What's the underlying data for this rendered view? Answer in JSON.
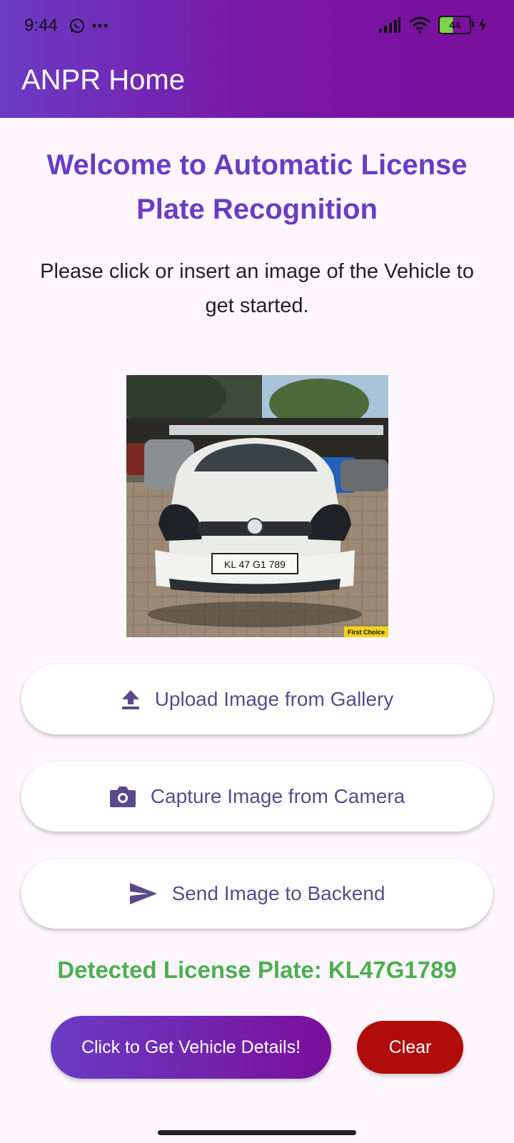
{
  "status_bar": {
    "time": "9:44",
    "battery_level": "44",
    "icons": [
      "whatsapp-icon",
      "more-dots-icon",
      "signal-icon",
      "wifi-icon",
      "battery-icon",
      "charging-icon"
    ]
  },
  "appbar": {
    "title": "ANPR Home"
  },
  "main": {
    "welcome": "Welcome to Automatic License Plate Recognition",
    "subtitle": "Please click or insert an image of the Vehicle to get started.",
    "image": {
      "plate_text": "KL 47 G1 789",
      "watermark": "First Choice"
    }
  },
  "buttons": {
    "upload": {
      "label": "Upload Image from Gallery",
      "icon": "upload-icon"
    },
    "camera": {
      "label": "Capture Image from Camera",
      "icon": "camera-icon"
    },
    "send": {
      "label": "Send Image to Backend",
      "icon": "send-icon"
    }
  },
  "result": {
    "detected_plate": "Detected License Plate: KL47G1789"
  },
  "actions": {
    "details_label": "Click to Get Vehicle Details!",
    "clear_label": "Clear"
  },
  "colors": {
    "primary": "#6a3cc4",
    "secondary": "#7a0f9c",
    "success": "#4caf50",
    "danger": "#b00c0c",
    "background": "#fdf6fd"
  }
}
